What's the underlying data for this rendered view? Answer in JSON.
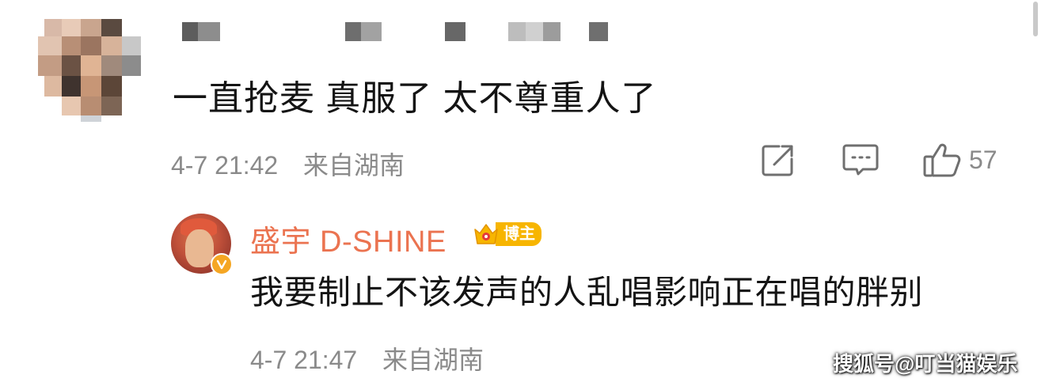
{
  "comment": {
    "text": "一直抢麦 真服了 太不尊重人了",
    "time": "4-7 21:42",
    "location": "来自湖南",
    "likes": "57",
    "icons": {
      "share": "share-icon",
      "comment": "comment-icon",
      "like": "like-icon"
    }
  },
  "reply": {
    "username": "盛宇 D-SHINE",
    "badge_label": "博主",
    "text": "我要制止不该发声的人乱唱影响正在唱的胖别",
    "time": "4-7 21:47",
    "location": "来自湖南"
  },
  "watermark": "搜狐号@叮当猫娱乐",
  "colors": {
    "username": "#eb7350",
    "meta": "#8a8a8a",
    "text": "#141414",
    "badge": "#f7b500"
  }
}
